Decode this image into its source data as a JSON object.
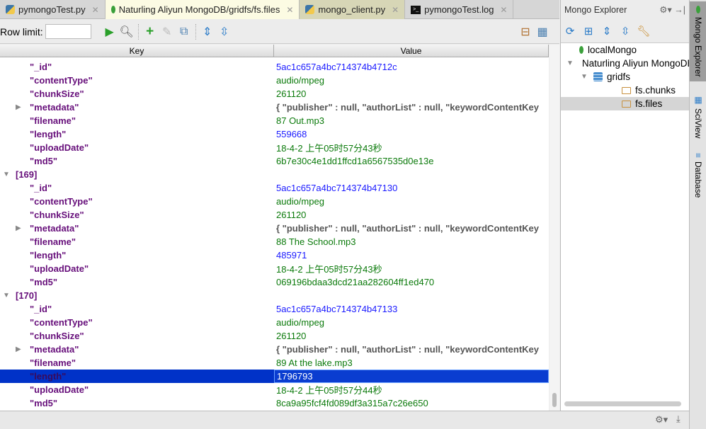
{
  "tabs": [
    {
      "label": "pymongoTest.py",
      "icon": "python-icon"
    },
    {
      "label": "Naturling Aliyun MongoDB/gridfs/fs.files",
      "icon": "mongo-leaf-icon",
      "active": true
    },
    {
      "label": "mongo_client.py",
      "icon": "python-icon"
    },
    {
      "label": "pymongoTest.log",
      "icon": "terminal-icon"
    }
  ],
  "toolbar": {
    "row_limit_label": "Row limit:",
    "row_limit_value": ""
  },
  "table": {
    "headers": [
      "Key",
      "Value"
    ],
    "rows": [
      {
        "key": "\"_id\"",
        "value": "5ac1c657a4bc714374b4712c",
        "type": "id"
      },
      {
        "key": "\"contentType\"",
        "value": "audio/mpeg",
        "type": "str"
      },
      {
        "key": "\"chunkSize\"",
        "value": "261120",
        "type": "str"
      },
      {
        "key": "\"metadata\"",
        "value": "{ \"publisher\" : null, \"authorList\" : null, \"keywordContentKey",
        "type": "obj",
        "expandable": true
      },
      {
        "key": "\"filename\"",
        "value": "87 Out.mp3",
        "type": "str"
      },
      {
        "key": "\"length\"",
        "value": "559668",
        "type": "num"
      },
      {
        "key": "\"uploadDate\"",
        "value": "18-4-2 上午05时57分43秒",
        "type": "str"
      },
      {
        "key": "\"md5\"",
        "value": "6b7e30c4e1dd1ffcd1a6567535d0e13e",
        "type": "str"
      },
      {
        "key": "[169]",
        "value": "",
        "type": "group"
      },
      {
        "key": "\"_id\"",
        "value": "5ac1c657a4bc714374b47130",
        "type": "id"
      },
      {
        "key": "\"contentType\"",
        "value": "audio/mpeg",
        "type": "str"
      },
      {
        "key": "\"chunkSize\"",
        "value": "261120",
        "type": "str"
      },
      {
        "key": "\"metadata\"",
        "value": "{ \"publisher\" : null, \"authorList\" : null, \"keywordContentKey",
        "type": "obj",
        "expandable": true
      },
      {
        "key": "\"filename\"",
        "value": "88 The School.mp3",
        "type": "str"
      },
      {
        "key": "\"length\"",
        "value": "485971",
        "type": "num"
      },
      {
        "key": "\"uploadDate\"",
        "value": "18-4-2 上午05时57分43秒",
        "type": "str"
      },
      {
        "key": "\"md5\"",
        "value": "069196bdaa3dcd21aa282604ff1ed470",
        "type": "str"
      },
      {
        "key": "[170]",
        "value": "",
        "type": "group"
      },
      {
        "key": "\"_id\"",
        "value": "5ac1c657a4bc714374b47133",
        "type": "id"
      },
      {
        "key": "\"contentType\"",
        "value": "audio/mpeg",
        "type": "str"
      },
      {
        "key": "\"chunkSize\"",
        "value": "261120",
        "type": "str"
      },
      {
        "key": "\"metadata\"",
        "value": "{ \"publisher\" : null, \"authorList\" : null, \"keywordContentKey",
        "type": "obj",
        "expandable": true
      },
      {
        "key": "\"filename\"",
        "value": "89 At the lake.mp3",
        "type": "str"
      },
      {
        "key": "\"length\"",
        "value": "1796793",
        "type": "num",
        "selected": true
      },
      {
        "key": "\"uploadDate\"",
        "value": "18-4-2 上午05时57分44秒",
        "type": "str"
      },
      {
        "key": "\"md5\"",
        "value": "8ca9a95fcf4fd089df3a315a7c26e650",
        "type": "str"
      }
    ]
  },
  "colors": {
    "id": "#1a1aff",
    "num": "#1a1aff",
    "str": "#0b7a0b",
    "obj": "#555555",
    "selection": "#0032c8"
  },
  "explorer": {
    "title": "Mongo Explorer",
    "nodes": [
      {
        "label": "localMongo",
        "icon": "mongo-leaf-icon",
        "depth": 0
      },
      {
        "label": "Naturling Aliyun MongoDB",
        "icon": "mongo-leaf-icon",
        "depth": 0,
        "expanded": true
      },
      {
        "label": "gridfs",
        "icon": "database-icon",
        "depth": 1,
        "expanded": true
      },
      {
        "label": "fs.chunks",
        "icon": "folder-icon",
        "depth": 2
      },
      {
        "label": "fs.files",
        "icon": "folder-icon",
        "depth": 2,
        "selected": true
      }
    ]
  },
  "side_tabs": [
    "Mongo Explorer",
    "SciView",
    "Database"
  ]
}
